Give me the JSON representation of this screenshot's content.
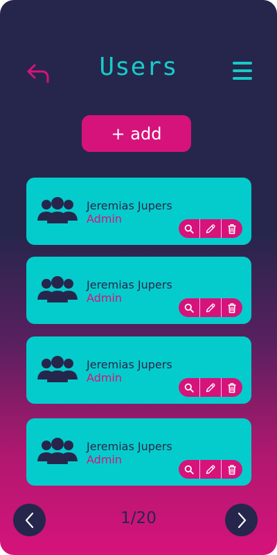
{
  "header": {
    "title": "Users",
    "back_icon": "back-arrow-icon",
    "menu_icon": "hamburger-menu-icon"
  },
  "add_button": {
    "label": "+ add"
  },
  "users": [
    {
      "name": "Jeremias Jupers",
      "role": "Admin"
    },
    {
      "name": "Jeremias Jupers",
      "role": "Admin"
    },
    {
      "name": "Jeremias Jupers",
      "role": "Admin"
    },
    {
      "name": "Jeremias Jupers",
      "role": "Admin"
    }
  ],
  "card_actions": [
    "search-icon",
    "pencil-icon",
    "trash-icon"
  ],
  "pagination": {
    "label": "1/20"
  },
  "colors": {
    "background_top": "#26264c",
    "background_bottom": "#d6137b",
    "accent_teal": "#16cbc8",
    "card": "#04cccc",
    "accent_pink": "#d6137b",
    "text_dark": "#26264c"
  }
}
